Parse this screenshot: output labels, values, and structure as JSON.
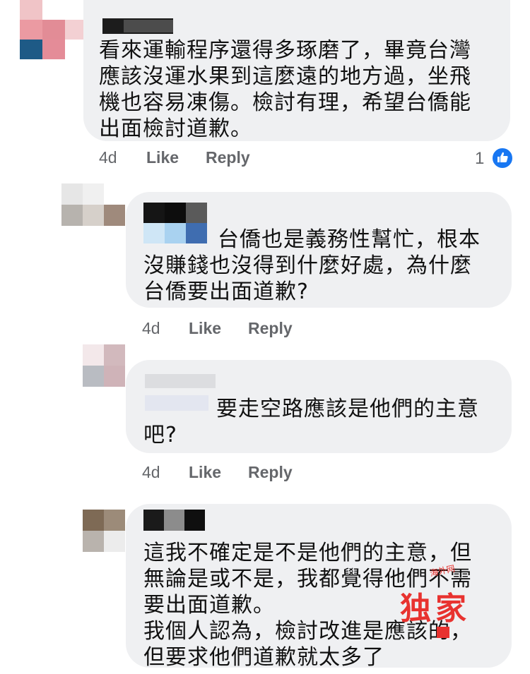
{
  "comments": [
    {
      "text_lines": [
        "看來運輸程序還得多琢磨了，畢竟台灣",
        "應該沒運水果到這麼遠的地方過，坐飛",
        "機也容易凍傷。檢討有理，希望台僑能",
        "出面檢討道歉。"
      ],
      "time": "4d",
      "like_label": "Like",
      "reply_label": "Reply",
      "reactions": "1"
    },
    {
      "text_lines": [
        "台僑也是義務性幫忙，根本",
        "沒賺錢也沒得到什麼好處，為什麼",
        "台僑要出面道歉?"
      ],
      "time": "4d",
      "like_label": "Like",
      "reply_label": "Reply"
    },
    {
      "text_lines": [
        "要走空路應該是他們的主意",
        "吧?"
      ],
      "time": "4d",
      "like_label": "Like",
      "reply_label": "Reply"
    },
    {
      "text_lines": [
        "這我不確定是不是他們的主意，但",
        "無論是或不是，我都覺得他們不需",
        "要出面道歉。",
        "我個人認為，檢討改進是應該的，",
        "但要求他們道歉就太多了"
      ]
    }
  ],
  "icons": {
    "reaction": "like-thumb-icon"
  },
  "watermark": {
    "main": "独家",
    "sub": "海外网"
  },
  "colors": {
    "bubble": "#eff0f2",
    "meta": "#65676b",
    "like_blue": "#1877f2",
    "watermark_red": "#e8322f"
  }
}
